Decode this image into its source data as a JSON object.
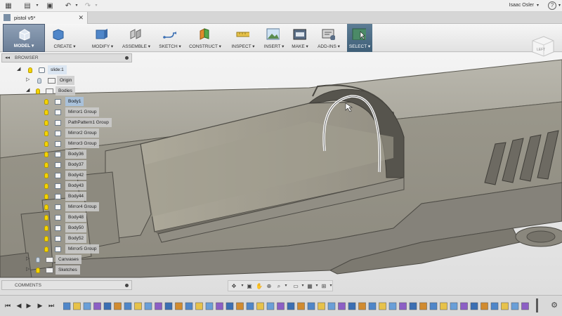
{
  "app": {
    "doc_tab_title": "pistol v5*",
    "user_name": "Isaac Osler",
    "help_label": "?"
  },
  "toolbar": {
    "items": [
      {
        "label": "MODEL ▾",
        "icon": "model-icon"
      },
      {
        "label": "CREATE ▾",
        "icon": "create-box-icon"
      },
      {
        "label": "MODIFY ▾",
        "icon": "modify-icon"
      },
      {
        "label": "ASSEMBLE ▾",
        "icon": "assemble-icon"
      },
      {
        "label": "SKETCH ▾",
        "icon": "sketch-icon"
      },
      {
        "label": "CONSTRUCT ▾",
        "icon": "construct-plane-icon"
      },
      {
        "label": "INSPECT ▾",
        "icon": "inspect-measure-icon"
      },
      {
        "label": "INSERT ▾",
        "icon": "insert-image-icon"
      },
      {
        "label": "MAKE ▾",
        "icon": "make-printer-icon"
      },
      {
        "label": "ADD-INS ▾",
        "icon": "add-ins-icon"
      },
      {
        "label": "SELECT ▾",
        "icon": "select-cursor-icon"
      }
    ]
  },
  "viewcube": {
    "face_label": "LEFT"
  },
  "browser": {
    "title": "BROWSER",
    "items": [
      {
        "label": "slide:1",
        "type": "root"
      },
      {
        "label": "Origin",
        "type": "folder"
      },
      {
        "label": "Bodies",
        "type": "folder"
      },
      {
        "label": "Body1",
        "type": "body",
        "selected": true
      },
      {
        "label": "Mirror1 Group",
        "type": "body"
      },
      {
        "label": "PathPattern1 Group",
        "type": "body"
      },
      {
        "label": "Mirror2 Group",
        "type": "body"
      },
      {
        "label": "Mirror3 Group",
        "type": "body"
      },
      {
        "label": "Body36",
        "type": "body"
      },
      {
        "label": "Body37",
        "type": "body"
      },
      {
        "label": "Body42",
        "type": "body"
      },
      {
        "label": "Body43",
        "type": "body"
      },
      {
        "label": "Body44",
        "type": "body"
      },
      {
        "label": "Mirror4 Group",
        "type": "body"
      },
      {
        "label": "Body48",
        "type": "body"
      },
      {
        "label": "Body50",
        "type": "body"
      },
      {
        "label": "Body52",
        "type": "body"
      },
      {
        "label": "Mirror5 Group",
        "type": "body"
      },
      {
        "label": "Canvases",
        "type": "folder"
      },
      {
        "label": "Sketches",
        "type": "folder"
      }
    ]
  },
  "comments": {
    "title": "COMMENTS"
  },
  "colors": {
    "accent_selected": "#a9c1da",
    "model_button": "#6a7d96",
    "bulb": "#f5d400",
    "body_surface": "#a09d91"
  }
}
